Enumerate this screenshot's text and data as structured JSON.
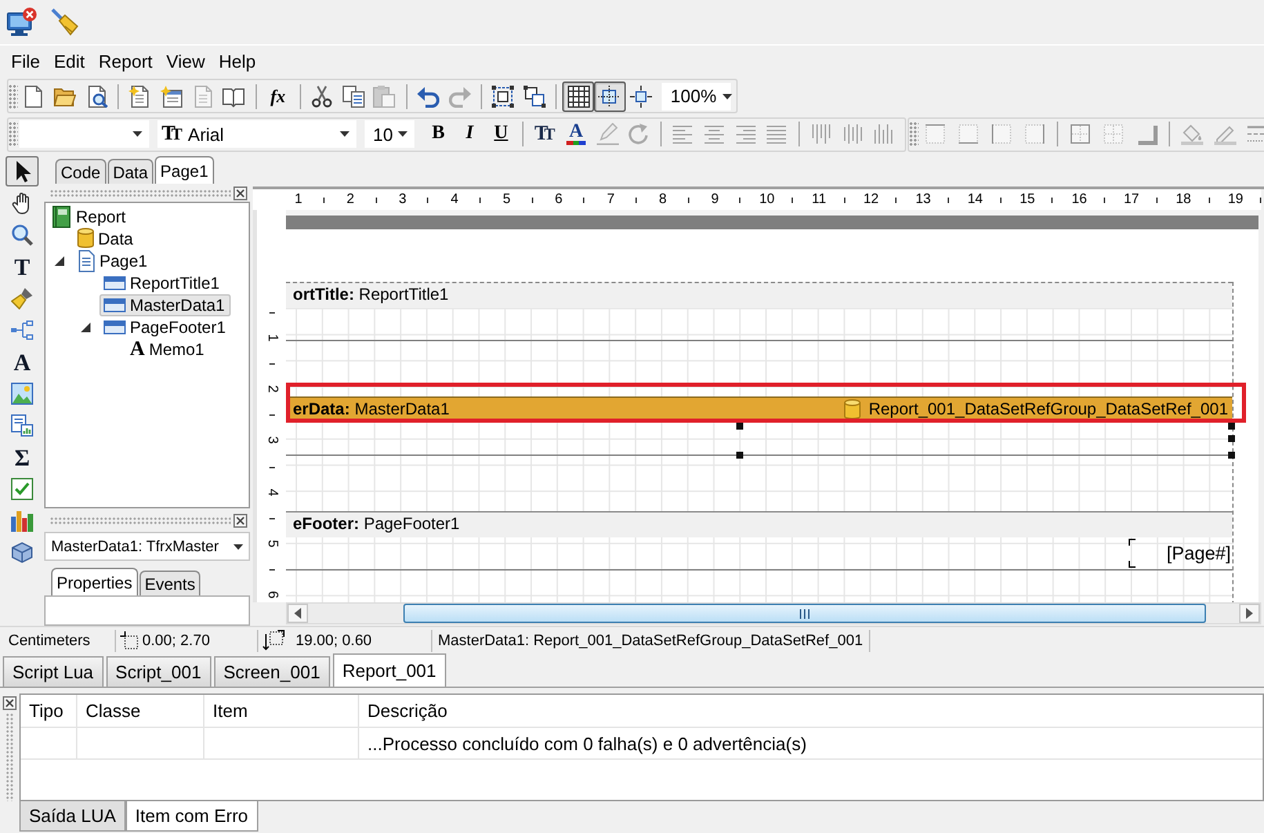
{
  "menu": [
    "File",
    "Edit",
    "Report",
    "View",
    "Help"
  ],
  "standard_toolbar": {
    "items": [
      {
        "kind": "button",
        "disabled": false
      },
      {
        "kind": "button",
        "disabled": false
      },
      {
        "kind": "button",
        "disabled": false
      },
      {
        "kind": "separator"
      },
      {
        "kind": "button",
        "disabled": false
      },
      {
        "kind": "button",
        "disabled": false
      },
      {
        "kind": "button",
        "disabled": true
      },
      {
        "kind": "button",
        "disabled": false
      },
      {
        "kind": "separator"
      },
      {
        "kind": "button",
        "glyph": "fx",
        "disabled": false
      },
      {
        "kind": "separator"
      },
      {
        "kind": "button",
        "disabled": false
      },
      {
        "kind": "button",
        "disabled": false
      },
      {
        "kind": "button",
        "disabled": true
      },
      {
        "kind": "separator"
      },
      {
        "kind": "button",
        "disabled": false
      },
      {
        "kind": "button",
        "disabled": true
      },
      {
        "kind": "separator"
      },
      {
        "kind": "button",
        "disabled": false
      },
      {
        "kind": "button",
        "disabled": false
      },
      {
        "kind": "separator"
      },
      {
        "kind": "toggle",
        "selected": true
      },
      {
        "kind": "toggle",
        "selected": true
      },
      {
        "kind": "toggle",
        "selected": false
      }
    ],
    "zoom": "100%"
  },
  "format_toolbar": {
    "font_field": {
      "glyph": "TT",
      "value": "Arial"
    },
    "size_field": {
      "value": "10"
    },
    "items": [
      {
        "kind": "button",
        "glyph": "B",
        "disabled": false
      },
      {
        "kind": "button",
        "glyph": "I",
        "disabled": false
      },
      {
        "kind": "button",
        "glyph": "U",
        "disabled": false
      },
      {
        "kind": "separator"
      },
      {
        "kind": "button",
        "glyph": "TT",
        "disabled": false
      },
      {
        "kind": "button",
        "glyph": "A",
        "disabled": false
      },
      {
        "kind": "button",
        "disabled": true
      },
      {
        "kind": "button",
        "disabled": true
      },
      {
        "kind": "separator"
      },
      {
        "kind": "button",
        "disabled": true
      },
      {
        "kind": "button",
        "disabled": true
      },
      {
        "kind": "button",
        "disabled": true
      },
      {
        "kind": "button",
        "disabled": true
      },
      {
        "kind": "separator"
      },
      {
        "kind": "button",
        "disabled": true
      },
      {
        "kind": "button",
        "disabled": true
      },
      {
        "kind": "button",
        "disabled": true
      }
    ]
  },
  "frame_toolbar": {
    "items": [
      {
        "kind": "button",
        "disabled": true
      },
      {
        "kind": "button",
        "disabled": true
      },
      {
        "kind": "button",
        "disabled": true
      },
      {
        "kind": "button",
        "disabled": true
      },
      {
        "kind": "separator"
      },
      {
        "kind": "button",
        "disabled": true
      },
      {
        "kind": "button",
        "disabled": true
      },
      {
        "kind": "button",
        "disabled": true
      },
      {
        "kind": "separator"
      },
      {
        "kind": "button",
        "disabled": true
      },
      {
        "kind": "button",
        "disabled": true
      },
      {
        "kind": "button",
        "disabled": true
      }
    ]
  },
  "tools": [
    {
      "selected": true
    },
    {
      "selected": false
    },
    {
      "selected": false
    },
    {
      "glyph": "T",
      "selected": false
    },
    {
      "selected": false
    },
    {
      "selected": false
    },
    {
      "glyph": "A",
      "selected": false
    },
    {
      "selected": false
    },
    {
      "selected": false
    },
    {
      "glyph": "Σ",
      "selected": false
    },
    {
      "selected": false
    },
    {
      "selected": false
    },
    {
      "selected": false
    }
  ],
  "designer_tabs": [
    {
      "label": "Code",
      "selected": false
    },
    {
      "label": "Data",
      "selected": false
    },
    {
      "label": "Page1",
      "selected": true
    }
  ],
  "report_tree": [
    {
      "kind": "report",
      "label": "Report",
      "selected": false,
      "children": [
        {
          "kind": "data",
          "label": "Data",
          "selected": false
        },
        {
          "kind": "page",
          "label": "Page1",
          "selected": false,
          "expanded": true,
          "children": [
            {
              "kind": "band",
              "label": "ReportTitle1",
              "selected": false
            },
            {
              "kind": "band",
              "label": "MasterData1",
              "selected": true
            },
            {
              "kind": "band",
              "label": "PageFooter1",
              "selected": false,
              "expanded": true,
              "children": [
                {
                  "kind": "memo",
                  "glyph": "A",
                  "label": "Memo1",
                  "selected": false
                }
              ]
            }
          ]
        }
      ]
    }
  ],
  "object_selector": {
    "value": "MasterData1: TfrxMaster"
  },
  "inspector_tabs": [
    {
      "label": "Properties",
      "selected": true
    },
    {
      "label": "Events",
      "selected": false
    }
  ],
  "rulers": {
    "horizontal": [
      "1",
      "2",
      "3",
      "4",
      "5",
      "6",
      "7",
      "8",
      "9",
      "10",
      "11",
      "12",
      "13",
      "14",
      "15",
      "16",
      "17",
      "18",
      "19"
    ],
    "vertical": [
      "1",
      "2",
      "3",
      "4",
      "5",
      "6"
    ]
  },
  "bands": [
    {
      "kind": "title",
      "label": "**ortTitle:** ReportTitle1",
      "selected": false,
      "highlighted": false
    },
    {
      "kind": "data",
      "label": "**erData:** MasterData1",
      "dataset": "Report_001_DataSetRefGroup_DataSetRef_001",
      "selected": true,
      "highlighted": true
    },
    {
      "kind": "footer",
      "label": "**eFooter:** PageFooter1",
      "memo": "[Page#]",
      "selected": false,
      "highlighted": false
    }
  ],
  "status_bar": {
    "units": "Centimeters",
    "position": "0.00; 2.70",
    "size": "19.00; 0.60",
    "info": "MasterData1: Report_001_DataSetRefGroup_DataSetRef_001"
  },
  "document_tabs": [
    {
      "label": "Script Lua",
      "selected": false
    },
    {
      "label": "Script_001",
      "selected": false
    },
    {
      "label": "Screen_001",
      "selected": false
    },
    {
      "label": "Report_001",
      "selected": true
    }
  ],
  "messages": {
    "columns": [
      "Tipo",
      "Classe",
      "Item",
      "Descrição"
    ],
    "rows": [
      {
        "descricao": "...Processo concluído com 0 falha(s) e 0 advertência(s)"
      }
    ]
  },
  "output_tabs": [
    {
      "label": "Saída LUA",
      "selected": false
    },
    {
      "label": "Item com Erro",
      "selected": true
    }
  ]
}
